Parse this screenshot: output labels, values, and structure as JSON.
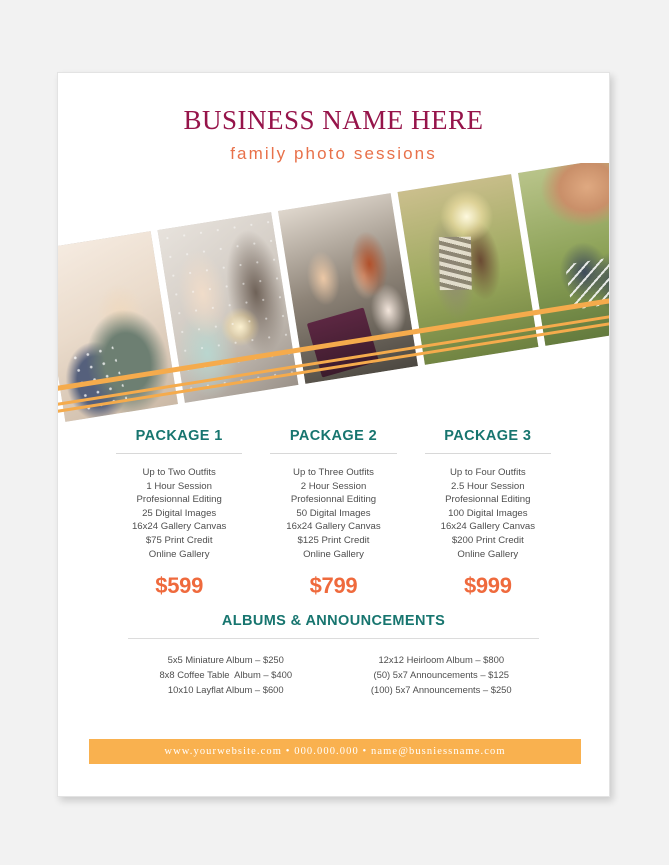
{
  "header": {
    "business_name": "BUSINESS NAME HERE",
    "tagline": "family photo sessions"
  },
  "photo_band": {
    "photos": [
      {
        "name": "photo-baby-on-shoulder",
        "alt": "Baby in polka dot outfit asleep on a parent's shoulder"
      },
      {
        "name": "photo-sparkler",
        "alt": "Father and young child holding a lit sparkler"
      },
      {
        "name": "photo-mother-toddler-baby",
        "alt": "Red haired mother with toddler and baby indoors with a tablet"
      },
      {
        "name": "photo-backlit-outdoors",
        "alt": "Adult lifting a child outdoors in backlit golden sunlight"
      },
      {
        "name": "photo-baby-shoes",
        "alt": "Hand holding a pair of navy baby sneakers"
      }
    ]
  },
  "packages": [
    {
      "title": "PACKAGE 1",
      "features": [
        "Up to Two Outfits",
        "1 Hour Session",
        "Profesionnal Editing",
        "25 Digital Images",
        "16x24 Gallery Canvas",
        "$75 Print Credit",
        "Online Gallery"
      ],
      "price": "$599"
    },
    {
      "title": "PACKAGE 2",
      "features": [
        "Up to Three Outfits",
        "2 Hour Session",
        "Profesionnal Editing",
        "50 Digital Images",
        "16x24 Gallery Canvas",
        "$125 Print Credit",
        "Online Gallery"
      ],
      "price": "$799"
    },
    {
      "title": "PACKAGE 3",
      "features": [
        "Up to Four Outfits",
        "2.5 Hour Session",
        "Profesionnal Editing",
        "100 Digital Images",
        "16x24 Gallery Canvas",
        "$200 Print Credit",
        "Online Gallery"
      ],
      "price": "$999"
    }
  ],
  "albums": {
    "title": "ALBUMS & ANNOUNCEMENTS",
    "left_column": [
      "5x5 Miniature Album – $250",
      "8x8 Coffee Table  Album – $400",
      "10x10 Layflat Album – $600"
    ],
    "right_column": [
      "12x12 Heirloom Album – $800",
      "(50) 5x7 Announcements – $125",
      "(100) 5x7 Announcements – $250"
    ]
  },
  "footer": {
    "website": "www.yourwebsite.com",
    "phone": "000.000.000",
    "email": "name@busniessname.com",
    "separator": "•",
    "text": "www.yourwebsite.com  •  000.000.000  •   name@busniessname.com"
  },
  "colors": {
    "title_maroon": "#96144a",
    "tagline_orange": "#e8714a",
    "heading_teal": "#17756f",
    "price_orange": "#ef6a3d",
    "stripe_orange": "#f5ab4c",
    "footer_bar": "#f9b14f",
    "page_background": "#f2f2f2",
    "sheet": "#ffffff"
  }
}
